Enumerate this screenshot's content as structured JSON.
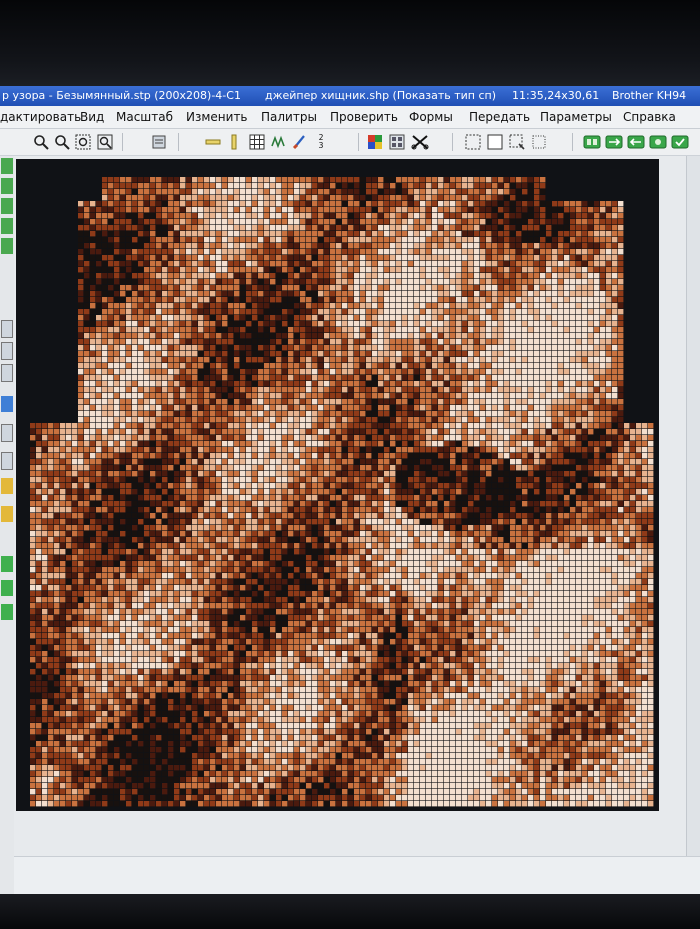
{
  "window": {
    "title_segments": [
      "р узора - Безымянный.stp (200x208)-4-C1",
      "джейпер хищник.shp (Показать тип сп)",
      "11:35,24x30,61",
      "Brother KH94"
    ]
  },
  "menu": {
    "items": [
      "дактировать",
      "Вид",
      "Масштаб",
      "Изменить",
      "Палитры",
      "Проверить",
      "Формы",
      "Передать",
      "Параметры",
      "Справка"
    ]
  },
  "toolbar": {
    "icons": [
      "zoom-in-icon",
      "zoom-out-icon",
      "zoom-fit-icon",
      "zoom-select-icon",
      "machine-icon",
      "ruler-h-icon",
      "ruler-v-icon",
      "grid-icon",
      "stitch-icon",
      "brush-icon",
      "colors-count-icon",
      "color-swatch-icon",
      "palette-grid-icon",
      "scissors-icon",
      "select-rect-icon",
      "select-box-icon",
      "crop-icon",
      "dotted-select-icon",
      "transfer-1-icon",
      "transfer-2-icon",
      "transfer-3-icon",
      "transfer-4-icon",
      "transfer-5-icon"
    ],
    "colors_count_label": "2\n3"
  },
  "pattern": {
    "palette": [
      "#f3dfcf",
      "#e7b38f",
      "#c9723f",
      "#8f3a18",
      "#4a1a0e",
      "#17110f"
    ],
    "background": "#101216"
  }
}
